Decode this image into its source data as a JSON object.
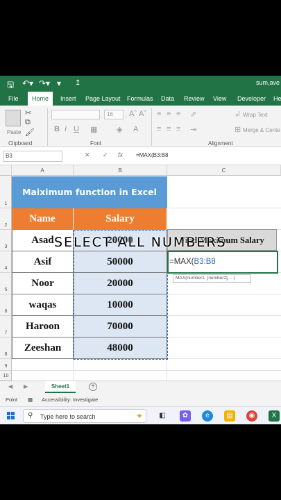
{
  "window": {
    "doc_title": "sum,ave"
  },
  "ribbon": {
    "tabs": [
      "File",
      "Home",
      "Insert",
      "Page Layout",
      "Formulas",
      "Data",
      "Review",
      "View",
      "Developer",
      "Hel"
    ],
    "active_tab": "Home",
    "groups": {
      "clipboard": "Clipboard",
      "font": "Font",
      "alignment": "Alignment"
    },
    "paste_label": "Paste",
    "font_size": "16",
    "wrap_text": "Wrap Text",
    "merge_center": "Merge & Cente"
  },
  "formula_bar": {
    "name_box": "B3",
    "content": "=MAX(B3:B8"
  },
  "grid": {
    "columns": [
      "A",
      "B",
      "C"
    ],
    "rows": [
      "1",
      "2",
      "3",
      "4",
      "5",
      "6",
      "7",
      "8",
      "9",
      "10"
    ],
    "table_title": "Maiximum function in Excel",
    "headers": {
      "name": "Name",
      "salary": "Salary"
    },
    "records": [
      {
        "name": "Asad",
        "salary": "20000"
      },
      {
        "name": "Asif",
        "salary": "50000"
      },
      {
        "name": "Noor",
        "salary": "20000"
      },
      {
        "name": "waqas",
        "salary": "10000"
      },
      {
        "name": "Haroon",
        "salary": "70000"
      },
      {
        "name": "Zeeshan",
        "salary": "48000"
      }
    ],
    "find_label": "Find Maximum Salary",
    "edit_prefix": "=MAX(",
    "edit_ref": "B3:B8",
    "tooltip": "MAX(number1, [number2], ...)"
  },
  "overlay_caption": "SELECT ALL NUMBERS",
  "sheet_tabs": {
    "active": "Sheet1"
  },
  "status": {
    "mode": "Point",
    "accessibility": "Accessibility: Investigate"
  },
  "taskbar": {
    "search_placeholder": "Type here to search"
  },
  "colors": {
    "excel_green": "#217346",
    "title_blue": "#5b9bd5",
    "header_orange": "#ed7d31",
    "selection_fill": "#dde7f3",
    "find_gray": "#d9d9d9"
  }
}
